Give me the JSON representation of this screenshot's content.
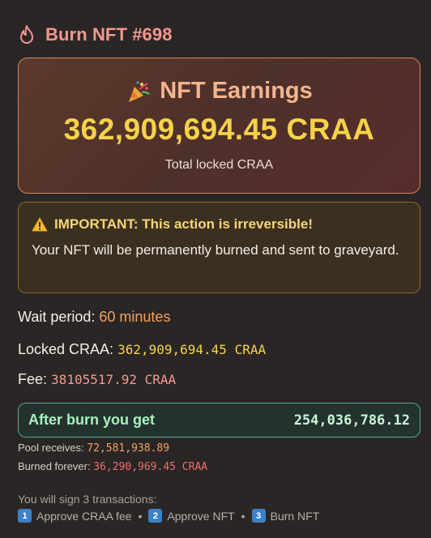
{
  "header": {
    "title": "Burn NFT #698"
  },
  "earnings": {
    "title": "NFT Earnings",
    "amount": "362,909,694.45 CRAA",
    "subtitle": "Total locked CRAA"
  },
  "warning": {
    "title": "IMPORTANT: This action is irreversible!",
    "body": "Your NFT will be permanently burned and sent to graveyard."
  },
  "details": {
    "wait_label": "Wait period:",
    "wait_value": "60 minutes",
    "locked_label": "Locked CRAA:",
    "locked_value": "362,909,694.45 CRAA",
    "fee_label": "Fee:",
    "fee_value": "38105517.92 CRAA"
  },
  "after": {
    "label": "After burn you get",
    "value": "254,036,786.12"
  },
  "pool": {
    "label": "Pool receives:",
    "value": "72,581,938.89"
  },
  "burned": {
    "label": "Burned forever:",
    "value": "36,290,969.45 CRAA"
  },
  "sign": {
    "title": "You will sign 3 transactions:",
    "steps": [
      {
        "num": "1",
        "label": "Approve CRAA fee"
      },
      {
        "num": "2",
        "label": "Approve NFT"
      },
      {
        "num": "3",
        "label": "Burn NFT"
      }
    ],
    "separator": "•"
  },
  "colors": {
    "background": "#2a2625",
    "title": "#f4978e",
    "amount": "#f5d24a",
    "warning_border": "#8a6a2a",
    "success": "#a9f0bf"
  }
}
